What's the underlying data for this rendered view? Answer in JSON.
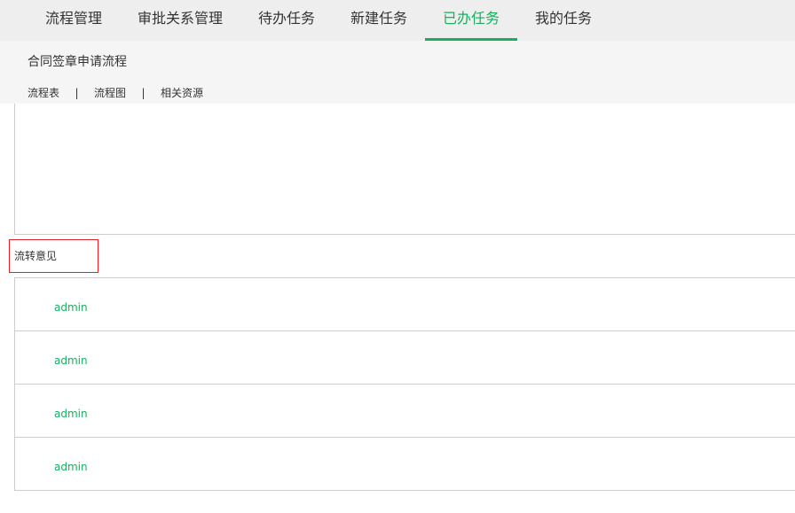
{
  "top_nav": {
    "tabs": [
      {
        "label": "流程管理"
      },
      {
        "label": "审批关系管理"
      },
      {
        "label": "待办任务"
      },
      {
        "label": "新建任务"
      },
      {
        "label": "已办任务",
        "active": true
      },
      {
        "label": "我的任务"
      }
    ]
  },
  "process": {
    "title": "合同签章申请流程",
    "subtabs": [
      {
        "label": "流程表"
      },
      {
        "label": "流程图"
      },
      {
        "label": "相关资源"
      }
    ],
    "separator": "|"
  },
  "opinions": {
    "label": "流转意见",
    "items": [
      {
        "user": "admin"
      },
      {
        "user": "admin"
      },
      {
        "user": "admin"
      },
      {
        "user": "admin"
      }
    ]
  },
  "colors": {
    "accent": "#1aad5f",
    "highlight_border": "#d9262c",
    "nav_background": "#eeeeee",
    "subheader_background": "#f5f5f5"
  }
}
